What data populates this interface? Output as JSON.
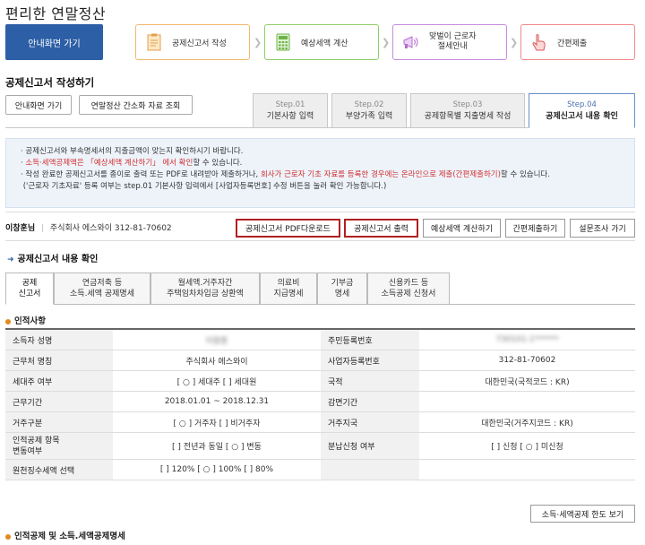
{
  "app_title": "편리한 연말정산",
  "home_button": "안내화면 가기",
  "flow": [
    {
      "label": "공제신고서 작성",
      "color": "#f0b870",
      "icon": "document-icon"
    },
    {
      "label": "예상세액 계산",
      "color": "#8fcf6a",
      "icon": "calculator-icon"
    },
    {
      "label": "맞벌이 근로자\n절세안내",
      "color": "#c98be0",
      "icon": "megaphone-icon"
    },
    {
      "label": "간편제출",
      "color": "#f08a8a",
      "icon": "hand-pointer-icon"
    }
  ],
  "page_heading": "공제신고서 작성하기",
  "sub_buttons": [
    "안내화면 가기",
    "연말정산 간소화 자료 조회"
  ],
  "steps": [
    {
      "num": "Step.01",
      "label": "기본사항 입력"
    },
    {
      "num": "Step.02",
      "label": "부양가족 입력"
    },
    {
      "num": "Step.03",
      "label": "공제항목별 지출명세 작성"
    },
    {
      "num": "Step.04",
      "label": "공제신고서 내용 확인"
    }
  ],
  "notice": {
    "line1": "공제신고서와 부속명세서의 지출금액이 맞는지 확인하시기 바랍니다.",
    "line2_red": "소득·세액공제액은 「예상세액 계산하기」 에서 확인",
    "line2_rest": "할 수 있습니다.",
    "line3_a": "작성 완료한 공제신고서를 종이로 출력 또는 PDF로 내려받아 제출하거나, ",
    "line3_red": "회사가 근로자 기초 자료를 등록한 경우에는 온라인으로 제출(간편제출하기)",
    "line3_b": "할 수 있습니다.",
    "line4": "('근로자 기초자료' 등록 여부는 step.01 기본사항 입력에서 [사업자등록번호] 수정 버튼을 눌러 확인 가능합니다.)"
  },
  "user": {
    "name": "이창훈님",
    "company": "주식회사 에스와이 312-81-70602"
  },
  "action_buttons": [
    "공제신고서 PDF다운로드",
    "공제신고서 출력",
    "예상세액 계산하기",
    "간편제출하기",
    "설문조사 가기"
  ],
  "section_title": "공제신고서 내용 확인",
  "tabs": [
    "공제\n신고서",
    "연금저축 등\n소득.세액 공제명세",
    "월세액.거주자간\n주택임차차입금 상환액",
    "의료비\n지급명세",
    "기부금\n명세",
    "신용카드 등\n소득공제 신청서"
  ],
  "personal_heading": "인적사항",
  "personal_rows": [
    {
      "l1": "소득자 성명",
      "v1": "이창훈",
      "l2": "주민등록번호",
      "v2": "730101-1******"
    },
    {
      "l1": "근무처 명칭",
      "v1": "주식회사 에스와이",
      "l2": "사업자등록번호",
      "v2": "312-81-70602"
    },
    {
      "l1": "세대주 여부",
      "v1": "[ ○ ] 세대주 [    ] 세대원",
      "l2": "국적",
      "v2": "대한민국(국적코드 : KR)"
    },
    {
      "l1": "근무기간",
      "v1": "2018.01.01 ~ 2018.12.31",
      "l2": "감면기간",
      "v2": ""
    },
    {
      "l1": "거주구분",
      "v1": "[ ○ ] 거주자  [    ] 비거주자",
      "l2": "거주지국",
      "v2": "대한민국(거주지코드 : KR)"
    },
    {
      "l1": "인적공제 항목\n변동여부",
      "v1": "[    ] 전년과 동일 [ ○ ] 변동",
      "l2": "분납신청 여부",
      "v2": "[    ] 신청 [ ○ ] 미신청"
    },
    {
      "l1": "원천징수세액 선택",
      "v1": "[    ] 120%  [ ○ ] 100% [    ] 80%",
      "l2": "",
      "v2": ""
    }
  ],
  "limit_button": "소득·세액공제 한도 보기",
  "bottom_heading": "인적공제 및 소득.세액공제명세"
}
